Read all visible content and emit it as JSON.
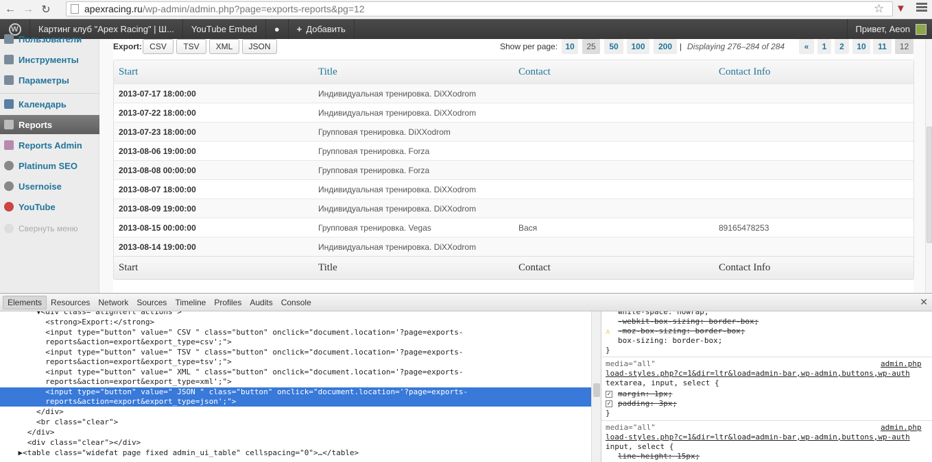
{
  "browser": {
    "url_host": "apexracing.ru",
    "url_path": "/wp-admin/admin.php?page=exports-reports&pg=12"
  },
  "admin_bar": {
    "site": "Картинг клуб \"Apex Racing\" | Ш...",
    "youtube": "YouTube Embed",
    "add_new": "Добавить",
    "greeting": "Привет, Aeon"
  },
  "sidebar": {
    "items": [
      {
        "label": "Пользователи"
      },
      {
        "label": "Инструменты"
      },
      {
        "label": "Параметры"
      },
      {
        "label": "Календарь"
      },
      {
        "label": "Reports"
      },
      {
        "label": "Reports Admin"
      },
      {
        "label": "Platinum SEO"
      },
      {
        "label": "Usernoise"
      },
      {
        "label": "YouTube"
      }
    ],
    "collapse": "Свернуть меню"
  },
  "export": {
    "label": "Export:",
    "buttons": [
      "CSV",
      "TSV",
      "XML",
      "JSON"
    ],
    "per_page_label": "Show per page:",
    "per_page": [
      "10",
      "25",
      "50",
      "100",
      "200"
    ],
    "separator": "|",
    "displaying": "Displaying 276–284 of 284",
    "pages": [
      "«",
      "1",
      "2",
      "10",
      "11",
      "12"
    ]
  },
  "table": {
    "columns": [
      "Start",
      "Title",
      "Contact",
      "Contact Info"
    ],
    "rows": [
      [
        "2013-07-17 18:00:00",
        "Индивидуальная тренировка. DiXXodrom",
        "",
        ""
      ],
      [
        "2013-07-22 18:00:00",
        "Индивидуальная тренировка. DiXXodrom",
        "",
        ""
      ],
      [
        "2013-07-23 18:00:00",
        "Групповая тренировка. DiXXodrom",
        "",
        ""
      ],
      [
        "2013-08-06 19:00:00",
        "Групповая тренировка. Forza",
        "",
        ""
      ],
      [
        "2013-08-08 00:00:00",
        "Групповая тренировка. Forza",
        "",
        ""
      ],
      [
        "2013-08-07 18:00:00",
        "Индивидуальная тренировка. DiXXodrom",
        "",
        ""
      ],
      [
        "2013-08-09 19:00:00",
        "Индивидуальная тренировка. DiXXodrom",
        "",
        ""
      ],
      [
        "2013-08-15 00:00:00",
        "Групповая тренировка. Vegas",
        "Вася",
        "89165478253"
      ],
      [
        "2013-08-14 19:00:00",
        "Индивидуальная тренировка. DiXXodrom",
        "",
        ""
      ]
    ]
  },
  "devtools": {
    "tabs": [
      "Elements",
      "Resources",
      "Network",
      "Sources",
      "Timeline",
      "Profiles",
      "Audits",
      "Console"
    ],
    "elements": [
      "        ▼<div class=\"alignleft actions\">",
      "          <strong>Export:</strong>",
      "          <input type=\"button\" value=\" CSV \" class=\"button\" onclick=\"document.location='?page=exports-",
      "          reports&action=export&export_type=csv';\">",
      "          <input type=\"button\" value=\" TSV \" class=\"button\" onclick=\"document.location='?page=exports-",
      "          reports&action=export&export_type=tsv';\">",
      "          <input type=\"button\" value=\" XML \" class=\"button\" onclick=\"document.location='?page=exports-",
      "          reports&action=export&export_type=xml';\">",
      "          <input type=\"button\" value=\" JSON \" class=\"button\" onclick=\"document.location='?page=exports-",
      "          reports&action=export&export_type=json';\">",
      "        </div>",
      "        <br class=\"clear\">",
      "      </div>",
      "      <div class=\"clear\"></div>",
      "    ▶<table class=\"widefat page fixed admin_ui_table\" cellspacing=\"0\">…</table>"
    ],
    "styles": {
      "rule1": [
        "white-space: nowrap;",
        "-webkit-box-sizing: border-box;",
        "-moz-box-sizing: border-box;",
        "box-sizing: border-box;",
        "}"
      ],
      "rule2_media": "media=\"all\"",
      "rule2_file": "admin.php",
      "rule2_source": "load-styles.php?c=1&dir=ltr&load=admin-bar,wp-admin,buttons,wp-auth",
      "rule2_selector": "textarea, input, select {",
      "rule2_props": [
        "margin: 1px;",
        "padding: 3px;"
      ],
      "rule2_close": "}",
      "rule3_media": "media=\"all\"",
      "rule3_file": "admin.php",
      "rule3_source": "load-styles.php?c=1&dir=ltr&load=admin-bar,wp-admin,buttons,wp-auth",
      "rule3_selector": "input, select {",
      "rule3_prop": "line-height: 15px;"
    }
  }
}
